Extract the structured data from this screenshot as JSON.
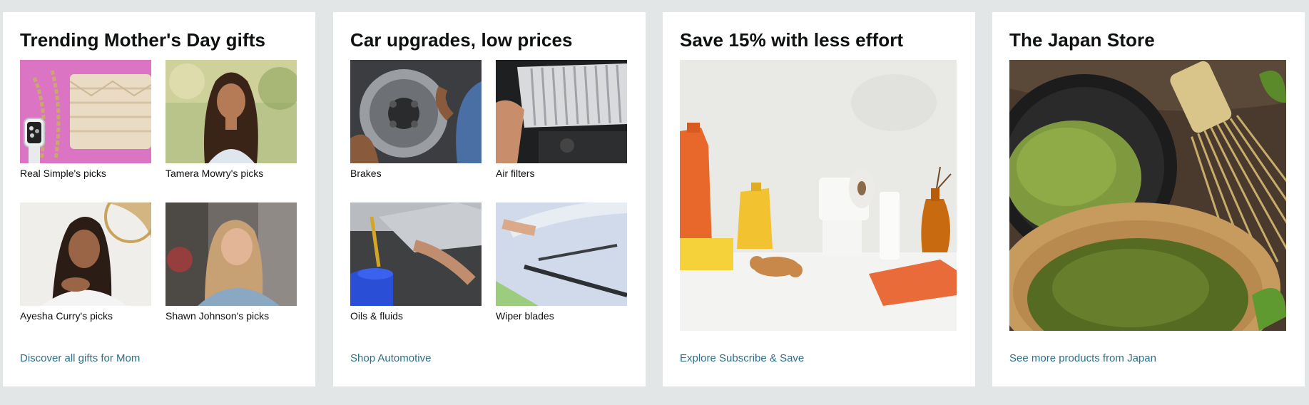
{
  "cards": [
    {
      "title": "Trending Mother's Day gifts",
      "tiles": [
        {
          "caption": "Real Simple's picks",
          "image": "watch-and-purse-photo"
        },
        {
          "caption": "Tamera Mowry's picks",
          "image": "woman-portrait-photo"
        },
        {
          "caption": "Ayesha Curry's picks",
          "image": "woman-portrait-photo"
        },
        {
          "caption": "Shawn Johnson's picks",
          "image": "woman-smiling-photo"
        }
      ],
      "link": "Discover all gifts for Mom"
    },
    {
      "title": "Car upgrades, low prices",
      "tiles": [
        {
          "caption": "Brakes",
          "image": "brake-rotor-photo"
        },
        {
          "caption": "Air filters",
          "image": "air-filter-photo"
        },
        {
          "caption": "Oils & fluids",
          "image": "oil-pour-photo"
        },
        {
          "caption": "Wiper blades",
          "image": "wiper-blade-photo"
        }
      ],
      "link": "Shop Automotive"
    },
    {
      "title": "Save 15% with less effort",
      "image": "household-products-photo",
      "link": "Explore Subscribe & Save"
    },
    {
      "title": "The Japan Store",
      "image": "matcha-tea-photo",
      "link": "See more products from Japan"
    }
  ],
  "colors": {
    "page_background": "#e3e6e6",
    "card_background": "#ffffff",
    "title_text": "#0f1111",
    "link_text": "#2b6f8a"
  }
}
